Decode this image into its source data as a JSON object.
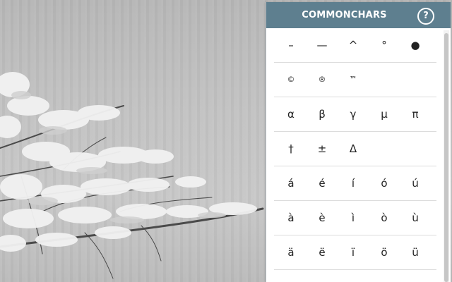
{
  "popup": {
    "title": "COMMONCHARS",
    "help_label": "?"
  },
  "rows": [
    {
      "chars": [
        "–",
        "—",
        "^",
        "°",
        "●"
      ]
    },
    {
      "chars": [
        "©",
        "®",
        "™"
      ]
    },
    {
      "chars": [
        "α",
        "β",
        "γ",
        "μ",
        "π"
      ]
    },
    {
      "chars": [
        "†",
        "±",
        "Δ"
      ]
    },
    {
      "chars": [
        "á",
        "é",
        "í",
        "ó",
        "ú"
      ]
    },
    {
      "chars": [
        "à",
        "è",
        "ì",
        "ò",
        "ù"
      ]
    },
    {
      "chars": [
        "ä",
        "ë",
        "ï",
        "ö",
        "ü"
      ]
    }
  ],
  "colors": {
    "header": "#5e7f8f",
    "panel": "#ffffff",
    "text": "#222222"
  }
}
